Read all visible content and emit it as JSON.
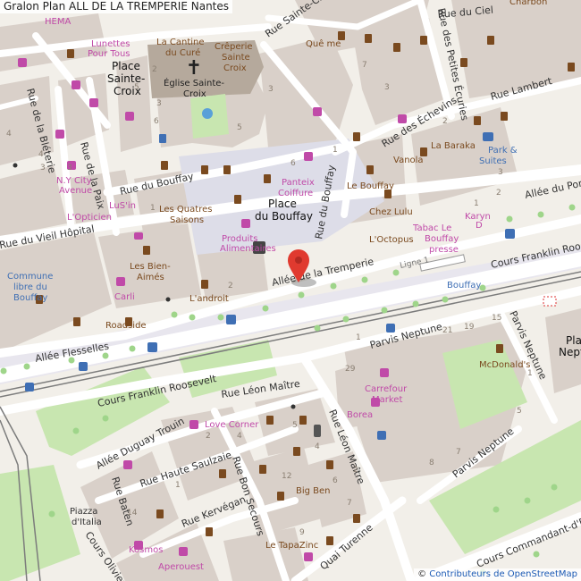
{
  "header": {
    "title": "Gralon Plan ALL DE LA TREMPERIE Nantes"
  },
  "attribution": {
    "prefix": "© ",
    "link_text": "Contributeurs de OpenStreetMap"
  },
  "marker": {
    "color": "#e03a2f"
  },
  "colors": {
    "background": "#f2efe9",
    "building": "#d9d0c9",
    "church": "#b5a99c",
    "road": "#ffffff",
    "pedestrian": "#dddde8",
    "park": "#c8e6b0",
    "shop": "#c04aa8",
    "food": "#7a4a1f",
    "transport": "#3f6fb4",
    "tree": "#9fd58a"
  },
  "streets": [
    "Rue du Vieil Hôpital",
    "Rue de la Bléterie",
    "Rue de la Paix",
    "Rue du Bouffay",
    "Allée de la Tremperie",
    "Allée Flesselles",
    "Cours Franklin Roosevelt",
    "Cours Franklin Roosevelt",
    "Rue Léon Maître",
    "Allée Duguay Trouin",
    "Rue Haute Saulzaie",
    "Rue Bon Secours",
    "Rue Kervégan",
    "Rue Baten",
    "Cours Olivier",
    "Parvis Neptune",
    "Parvis Neptune",
    "Parvis Neptune",
    "Rue Léon Maître",
    "Quai Turenne",
    "Cours Commandant-d'Es",
    "Rue du Bouffay",
    "Rue des Échevins",
    "Rue Lambert",
    "Rue des Petites Écuries",
    "Rue du Ciel",
    "Allée du Port",
    "Rue Sainte-Croix"
  ],
  "places": [
    "Place",
    "Sainte-",
    "Croix",
    "Place",
    "du Bouffay",
    "Église Sainte-",
    "Croix",
    "Piazza",
    "d'Italia",
    "Place",
    "Nept"
  ],
  "pois": [
    "Lunettes",
    "Pour Tous",
    "La Cantine",
    "du Curé",
    "Crêperie",
    "Sainte",
    "Croix",
    "Quê me",
    "Panteix",
    "Coiffure",
    "Le Bouffay",
    "La Baraka",
    "Vanola",
    "Park &",
    "Suites",
    "Chez Lulu",
    "Tabac Le",
    "Bouffay",
    "presse",
    "Karyn",
    "D",
    "L'Octopus",
    "N.Y City",
    "Avenue",
    "LuS'in",
    "Les Quatres",
    "Saisons",
    "L'Opticien",
    "Produits",
    "Alimentaires",
    "Les Bien-",
    "Aimés",
    "Carli",
    "L'androit",
    "Roadside",
    "Commune",
    "libre du",
    "Bouffay",
    "Bouffay",
    "McDonald's",
    "Carrefour",
    "Market",
    "Borea",
    "Love Corner",
    "Big Ben",
    "Le TapaZinc",
    "Kosmos",
    "Aperouest",
    "HEMA",
    "Charbon",
    "Ligne 1"
  ],
  "house_numbers": [
    "3",
    "6",
    "5",
    "2",
    "5",
    "3",
    "1",
    "7",
    "3",
    "2",
    "3",
    "4",
    "4",
    "1",
    "2",
    "6",
    "1",
    "3",
    "2",
    "29",
    "21",
    "19",
    "15",
    "1",
    "5",
    "7",
    "8",
    "2",
    "4",
    "5",
    "12",
    "9",
    "2",
    "1",
    "14",
    "4",
    "6",
    "7",
    "3",
    "1"
  ]
}
